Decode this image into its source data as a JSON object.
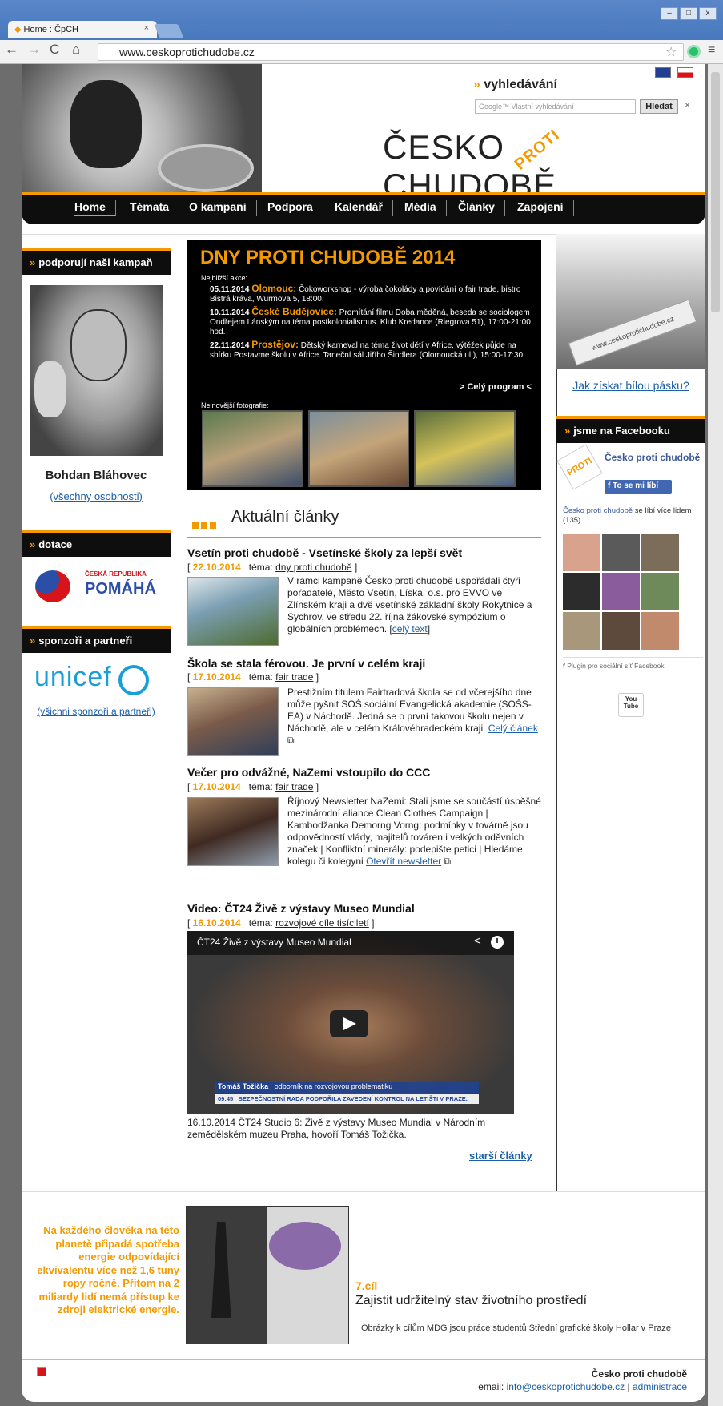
{
  "browser": {
    "tab_title": "Home : ČpCH",
    "tab_close": "×",
    "url": "www.ceskoprotichudobe.cz",
    "window_controls": [
      "–",
      "□",
      "x"
    ]
  },
  "header": {
    "search_label": "vyhledávání",
    "search_prefix": "»",
    "search_placeholder": "Google™ Vlastní vyhledávání",
    "search_button": "Hledat",
    "search_clear": "×",
    "logo_left": "ČESKO",
    "logo_mid": "PROTI",
    "logo_right": "CHUDOBĚ"
  },
  "nav": {
    "items": [
      "Home",
      "Témata",
      "O kampani",
      "Podpora",
      "Kalendář",
      "Média",
      "Články",
      "Zapojení"
    ]
  },
  "left": {
    "campaign_title": "podporují naši kampaň",
    "person_name": "Bohdan Bláhovec",
    "all_people": "(všechny osobnosti)",
    "dotace_title": "dotace",
    "dotace_logo_top": "ČESKÁ REPUBLIKA",
    "dotace_logo_bottom": "POMÁHÁ",
    "sponsors_title": "sponzoři a partneři",
    "unicef": "unicef",
    "all_sponsors": "(všichni sponzoři a partneři)",
    "bar_prefix": "»"
  },
  "dny": {
    "title": "DNY PROTI CHUDOBĚ 2014",
    "nearest": "Nejbližší akce:",
    "events": [
      {
        "date": "05.11.2014",
        "city": "Olomouc:",
        "text": "Čokoworkshop - výroba čokolády a povídání o fair trade, bistro Bistrá kráva, Wurmova 5, 18:00."
      },
      {
        "date": "10.11.2014",
        "city": "České Budějovice:",
        "text": "Promítání filmu Doba měděná, beseda se sociologem Ondřejem Lánským na téma postkolonialismus. Klub Kredance (Riegrova 51), 17:00-21:00 hod."
      },
      {
        "date": "22.11.2014",
        "city": "Prostějov:",
        "text": "Dětský karneval na téma život dětí v Africe, výtěžek půjde na sbírku Postavme školu v Africe. Taneční sál Jiřího Šindlera (Olomoucká ul.), 15:00-17:30."
      }
    ],
    "program": "> Celý program <",
    "photos_label": "Nejnovější fotografie:"
  },
  "articles_heading": "Aktuální články",
  "articles": [
    {
      "title": "Vsetín proti chudobě - Vsetínské školy za lepší svět",
      "date": "22.10.2014",
      "topic_label": "téma:",
      "topic": "dny proti chudobě",
      "text": "V rámci kampaně Česko proti chudobě uspořádali čtyři pořadatelé, Město Vsetín, Líska, o.s. pro EVVO ve Zlínském kraji a dvě vsetínské základní školy Rokytnice a Sychrov, ve středu 22. října žákovské sympózium o globálních problémech.",
      "more": "celý text"
    },
    {
      "title": "Škola se stala férovou. Je první v celém kraji",
      "date": "17.10.2014",
      "topic_label": "téma:",
      "topic": "fair trade",
      "text": "Prestižním titulem Fairtradová škola se od včerejšího dne může pyšnit SOŠ sociální Evangelická akademie (SOŠS-EA) v Náchodě. Jedná se o první takovou školu nejen v Náchodě, ale v celém Královéhradeckém kraji.",
      "more": "Celý článek"
    },
    {
      "title": "Večer pro odvážné, NaZemi vstoupilo do CCC",
      "date": "17.10.2014",
      "topic_label": "téma:",
      "topic": "fair trade",
      "text": "Říjnový Newsletter NaZemi: Stali jsme se součástí úspěšné mezinárodní aliance Clean Clothes Campaign | Kambodžanka Demorng Vorng: podmínky v továrně jsou odpovědností vlády, majitelů továren i velkých oděvních značek | Konfliktní minerály: podepište petici | Hledáme kolegu či kolegyni",
      "more": "Otevřít newsletter"
    },
    {
      "title": "Video: ČT24 Živě z výstavy Museo Mundial",
      "date": "16.10.2014",
      "topic_label": "téma:",
      "topic": "rozvojové cíle tisíciletí",
      "video_title": "ČT24 Živě z výstavy Museo Mundial",
      "caption1": "Tomáš Tožička",
      "caption2": "odborník na rozvojovou problematiku",
      "ticker_time": "09:45",
      "ticker": "BEZPEČNOSTNÍ RADA PODPOŘILA ZAVEDENÍ KONTROL NA LETIŠTI V PRAZE.",
      "text": "16.10.2014 ČT24 Studio 6: Živě z výstavy Museo Mundial v Národním zemědělském muzeu Praha, hovoří Tomáš Tožička."
    }
  ],
  "older": "starší články",
  "right": {
    "band_text": "www.ceskoprotichudobe.cz",
    "band_link": "Jak získat bílou pásku?",
    "fb_title": "jsme na Facebooku",
    "fb_page": "Česko proti chudobě",
    "fb_like": "To se mi líbí",
    "fb_count_link": "Česko proti chudobě",
    "fb_count_text": " se líbí více lidem (135).",
    "fb_plugin": "Plugin pro sociální síť Facebook",
    "youtube": "You Tube"
  },
  "footer": {
    "text": "Na každého člověka na této planetě připadá spotřeba energie odpovídající ekvivalentu více než 1,6 tuny ropy ročně. Přitom na 2 miliardy lidí nemá přístup ke zdroji elektrické energie.",
    "goal_num": "7.cíl",
    "goal_text": "Zajistit udržitelný stav životního prostředí",
    "credit": "Obrázky k cílům MDG jsou práce studentů Střední grafické školy Hollar v Praze",
    "org": "Česko proti chudobě",
    "email_label": "email: ",
    "email": "info@ceskoprotichudobe.cz",
    "admin": "administrace"
  },
  "colors": {
    "accent": "#f49a00",
    "dark": "#0e0e0e",
    "link": "#1a5fa8"
  }
}
